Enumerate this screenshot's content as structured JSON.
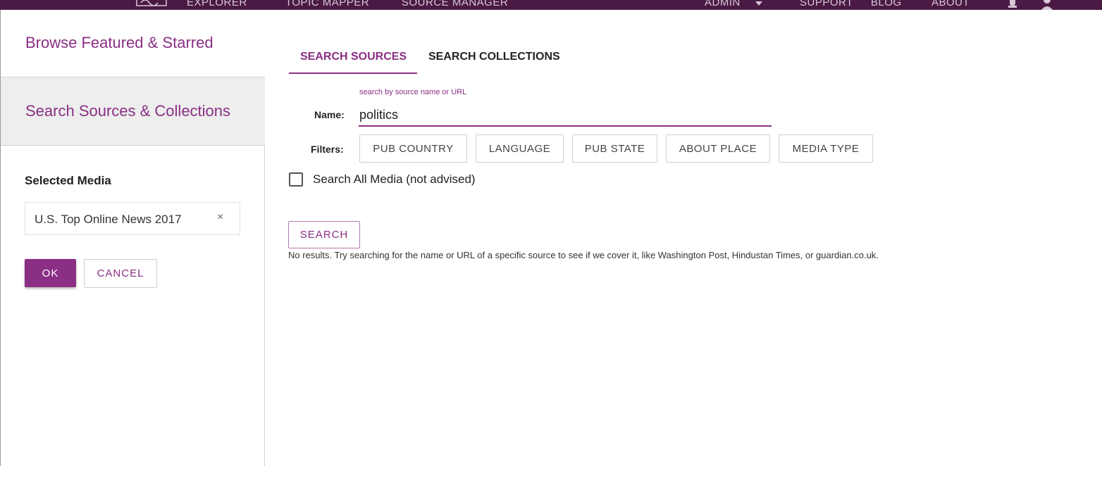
{
  "topnav": {
    "items": [
      "EXPLORER",
      "TOPIC MAPPER",
      "SOURCE MANAGER"
    ],
    "admin_label": "ADMIN",
    "right_items": [
      "SUPPORT",
      "BLOG",
      "ABOUT"
    ],
    "icons": [
      "logo-icon",
      "notification-icon",
      "user-icon"
    ]
  },
  "sidebar": {
    "browse_label": "Browse Featured & Starred",
    "search_label": "Search Sources & Collections",
    "selected_title": "Selected Media",
    "selected_items": [
      {
        "name": "U.S. Top Online News 2017",
        "remove": "×"
      }
    ],
    "ok_label": "OK",
    "cancel_label": "CANCEL"
  },
  "main": {
    "tabs": [
      {
        "label": "SEARCH SOURCES",
        "active": true
      },
      {
        "label": "SEARCH COLLECTIONS",
        "active": false
      }
    ],
    "name_hint": "search by source name or URL",
    "name_label": "Name:",
    "name_value": "politics",
    "filters_label": "Filters:",
    "filters": [
      "PUB COUNTRY",
      "LANGUAGE",
      "PUB STATE",
      "ABOUT PLACE",
      "MEDIA TYPE"
    ],
    "search_all_label": "Search All Media (not advised)",
    "search_all_checked": false,
    "search_button": "SEARCH",
    "no_results": "No results. Try searching for the name or URL of a specific source to see if we cover it, like Washington Post, Hindustan Times, or guardian.co.uk."
  },
  "colors": {
    "brand": "#8a2f84",
    "topbar": "#4a1a45",
    "sidebar_active_bg": "#eeeeee"
  }
}
